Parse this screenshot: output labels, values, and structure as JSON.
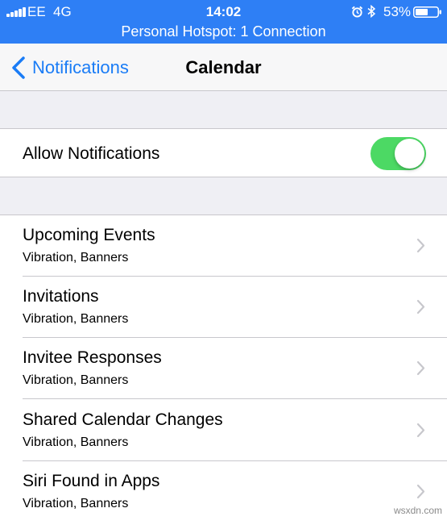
{
  "status_bar": {
    "carrier": "EE",
    "network": "4G",
    "time": "14:02",
    "battery_percent": "53%",
    "background_color": "#2e7ff5",
    "hotspot_text": "Personal Hotspot: 1 Connection",
    "icons": [
      "signal-icon",
      "alarm-icon",
      "bluetooth-icon",
      "battery-icon"
    ]
  },
  "nav": {
    "back_label": "Notifications",
    "title": "Calendar",
    "accent_color": "#1a7cf6"
  },
  "allow_notifications": {
    "label": "Allow Notifications",
    "enabled": true,
    "toggle_color": "#4cd964"
  },
  "items": [
    {
      "title": "Upcoming Events",
      "subtitle": "Vibration, Banners"
    },
    {
      "title": "Invitations",
      "subtitle": "Vibration, Banners"
    },
    {
      "title": "Invitee Responses",
      "subtitle": "Vibration, Banners"
    },
    {
      "title": "Shared Calendar Changes",
      "subtitle": "Vibration, Banners"
    },
    {
      "title": "Siri Found in Apps",
      "subtitle": "Vibration, Banners"
    }
  ],
  "watermark": "wsxdn.com"
}
